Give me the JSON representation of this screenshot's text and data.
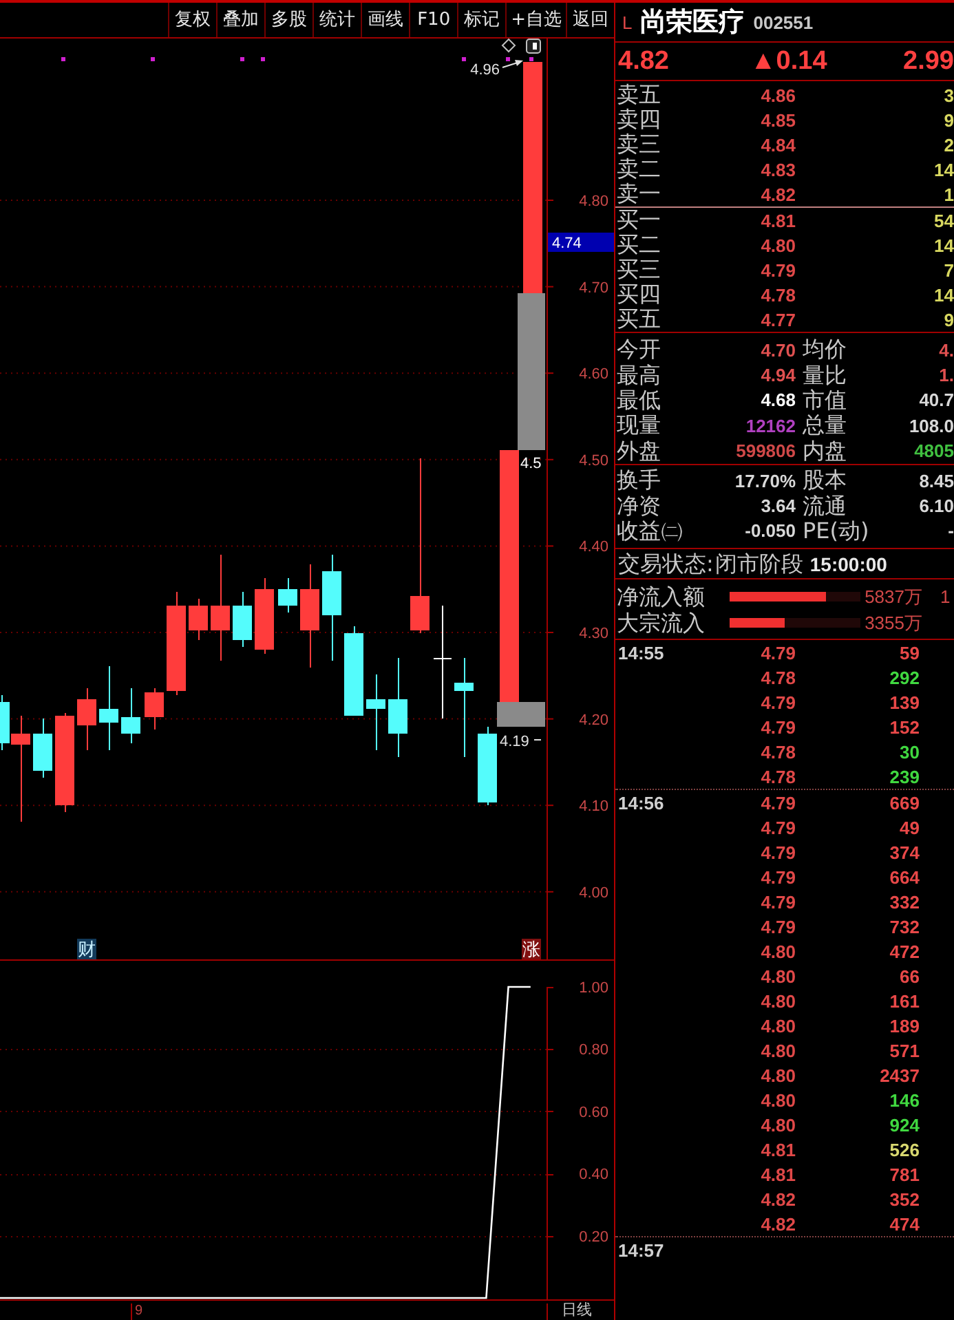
{
  "toolbar": {
    "buttons": [
      "复权",
      "叠加",
      "多股",
      "统计",
      "画线",
      "F10",
      "标记",
      "+自选",
      "返回"
    ]
  },
  "price_chart": {
    "annotations": [
      {
        "kind": "high",
        "text": "4.96"
      },
      {
        "kind": "gap_top",
        "text": "4.5"
      },
      {
        "kind": "low",
        "text": "4.19"
      }
    ],
    "markers": [
      {
        "kind": "finance",
        "text": "财"
      },
      {
        "kind": "rise",
        "text": "涨"
      }
    ],
    "axis_labels": [
      "4.80",
      "4.70",
      "4.60",
      "4.50",
      "4.40",
      "4.30",
      "4.20",
      "4.10",
      "4.00"
    ],
    "current_price": "4.74"
  },
  "indicator": {
    "chart_data": {
      "type": "line",
      "ylim": [
        0,
        1
      ],
      "yticks": [
        {
          "value": 1,
          "label": "1.00"
        },
        {
          "value": 0.8,
          "label": "0.80"
        },
        {
          "value": 0.6,
          "label": "0.60"
        },
        {
          "value": 0.4,
          "label": "0.40"
        },
        {
          "value": 0.2,
          "label": "0.20"
        }
      ],
      "grid": true,
      "series": [
        {
          "color": "#ffffff",
          "values": [
            0,
            0,
            0,
            0,
            0,
            0,
            0,
            0,
            0,
            0,
            0,
            0,
            0,
            0,
            0,
            0,
            0,
            0,
            0,
            0,
            0,
            0,
            0,
            1,
            1
          ]
        }
      ]
    }
  },
  "footer": {
    "date_label": "9",
    "period": "日线"
  },
  "quote": {
    "market": "L",
    "name": "尚荣医疗",
    "code": "002551",
    "price": "4.82",
    "change": "▲0.14",
    "change_percent": "2.99"
  },
  "order_book": {
    "asks": [
      {
        "label": "卖五",
        "price": "4.86",
        "volume": "3"
      },
      {
        "label": "卖四",
        "price": "4.85",
        "volume": "9"
      },
      {
        "label": "卖三",
        "price": "4.84",
        "volume": "2"
      },
      {
        "label": "卖二",
        "price": "4.83",
        "volume": "14"
      },
      {
        "label": "卖一",
        "price": "4.82",
        "volume": "1"
      }
    ],
    "bids": [
      {
        "label": "买一",
        "price": "4.81",
        "volume": "54"
      },
      {
        "label": "买二",
        "price": "4.80",
        "volume": "14"
      },
      {
        "label": "买三",
        "price": "4.79",
        "volume": "7"
      },
      {
        "label": "买四",
        "price": "4.78",
        "volume": "14"
      },
      {
        "label": "买五",
        "price": "4.77",
        "volume": "9"
      }
    ]
  },
  "summary": [
    {
      "left": {
        "label": "今开",
        "value": "4.70",
        "color": "#e05050"
      },
      "right": {
        "label": "均价",
        "value": "4.",
        "color": "#e05050"
      }
    },
    {
      "left": {
        "label": "最高",
        "value": "4.94",
        "color": "#e05050"
      },
      "right": {
        "label": "量比",
        "value": "1.",
        "color": "#e05050"
      }
    },
    {
      "left": {
        "label": "最低",
        "value": "4.68",
        "color": "#ffffff"
      },
      "right": {
        "label": "市值",
        "value": "40.7",
        "color": "#d8d8d8"
      }
    },
    {
      "left": {
        "label": "现量",
        "value": "12162",
        "color": "#b040c0"
      },
      "right": {
        "label": "总量",
        "value": "108.0",
        "color": "#d8d8d8"
      }
    },
    {
      "left": {
        "label": "外盘",
        "value": "599806",
        "color": "#d04848"
      },
      "right": {
        "label": "内盘",
        "value": "4805",
        "color": "#40c040"
      }
    }
  ],
  "capital": [
    {
      "left": {
        "label": "换手",
        "value": "17.70%",
        "color": "#d8d8d8"
      },
      "right": {
        "label": "股本",
        "value": "8.45",
        "color": "#d8d8d8"
      }
    },
    {
      "left": {
        "label": "净资",
        "value": "3.64",
        "color": "#d8d8d8"
      },
      "right": {
        "label": "流通",
        "value": "6.10",
        "color": "#d8d8d8"
      }
    },
    {
      "left": {
        "label": "收益㈡",
        "value": "-0.050",
        "color": "#d8d8d8"
      },
      "right": {
        "label": "PE(动)",
        "value": "-",
        "color": "#d8d8d8"
      }
    }
  ],
  "trade_status": {
    "label": "交易状态:",
    "phase": "闭市阶段",
    "time": "15:00:00"
  },
  "fund_flow": [
    {
      "label": "净流入额",
      "level": 0.74,
      "amount": "5837万",
      "column_4": "1"
    },
    {
      "label": "大宗流入",
      "level": 0.42,
      "amount": "3355万"
    }
  ],
  "ticks": [
    {
      "time": "14:55",
      "trades": [
        {
          "price": "4.79",
          "volume": "59",
          "color": "#e84848"
        },
        {
          "price": "4.78",
          "volume": "292",
          "color": "#40d840"
        },
        {
          "price": "4.79",
          "volume": "139",
          "color": "#e84848"
        },
        {
          "price": "4.79",
          "volume": "152",
          "color": "#e84848"
        },
        {
          "price": "4.78",
          "volume": "30",
          "color": "#40d840"
        },
        {
          "price": "4.78",
          "volume": "239",
          "color": "#40d840"
        }
      ]
    },
    {
      "time": "14:56",
      "trades": [
        {
          "price": "4.79",
          "volume": "669",
          "color": "#e84848"
        },
        {
          "price": "4.79",
          "volume": "49",
          "color": "#e84848"
        },
        {
          "price": "4.79",
          "volume": "374",
          "color": "#e84848"
        },
        {
          "price": "4.79",
          "volume": "664",
          "color": "#e84848"
        },
        {
          "price": "4.79",
          "volume": "332",
          "color": "#e84848"
        },
        {
          "price": "4.79",
          "volume": "732",
          "color": "#e84848"
        },
        {
          "price": "4.80",
          "volume": "472",
          "color": "#e84848"
        },
        {
          "price": "4.80",
          "volume": "66",
          "color": "#e84848"
        },
        {
          "price": "4.80",
          "volume": "161",
          "color": "#e84848"
        },
        {
          "price": "4.80",
          "volume": "189",
          "color": "#e84848"
        },
        {
          "price": "4.80",
          "volume": "571",
          "color": "#e84848"
        },
        {
          "price": "4.80",
          "volume": "2437",
          "color": "#e84848"
        },
        {
          "price": "4.80",
          "volume": "146",
          "color": "#40d840"
        },
        {
          "price": "4.80",
          "volume": "924",
          "color": "#40d840"
        },
        {
          "price": "4.81",
          "volume": "526",
          "color": "#d8d870"
        },
        {
          "price": "4.81",
          "volume": "781",
          "color": "#e84848"
        },
        {
          "price": "4.82",
          "volume": "352",
          "color": "#e84848"
        },
        {
          "price": "4.82",
          "volume": "474",
          "color": "#e84848"
        }
      ]
    },
    {
      "time": "14:57"
    }
  ]
}
